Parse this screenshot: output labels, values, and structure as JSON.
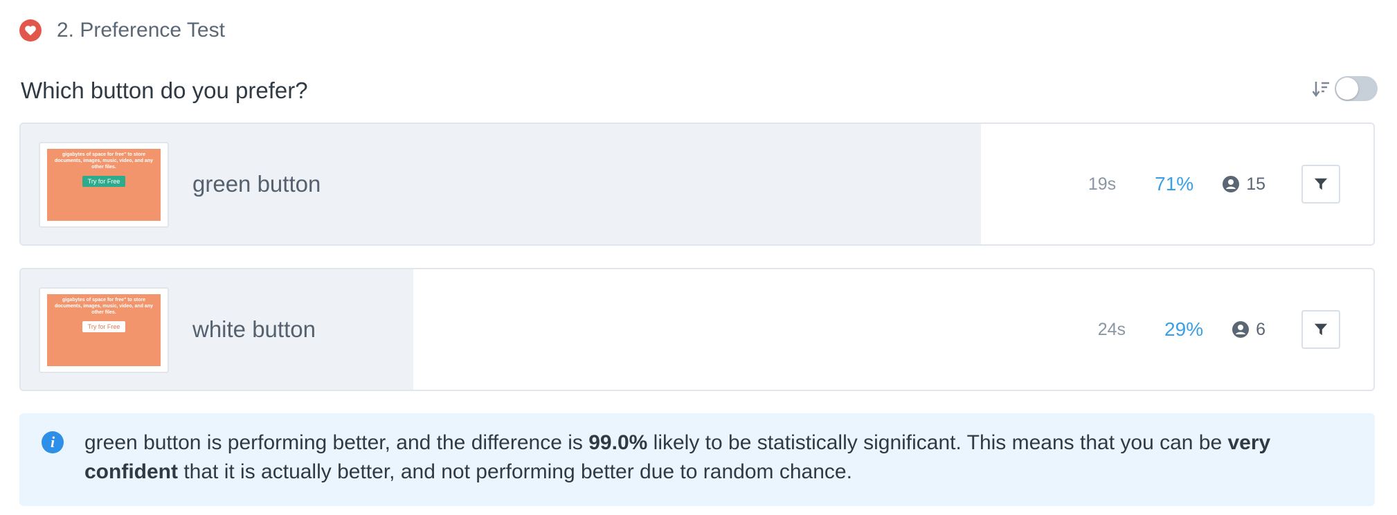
{
  "section": {
    "title": "2. Preference Test",
    "icon": "heart-icon",
    "accent_color": "#e2574c"
  },
  "question": "Which button do you prefer?",
  "controls": {
    "sort_icon": "sort-descending-icon",
    "toggle_on": false
  },
  "options": [
    {
      "label": "green button",
      "time": "19s",
      "percent": "71%",
      "share": 0.71,
      "count": "15",
      "thumbnail": {
        "text": "gigabytes of space for free\" to store documents, images, music, video, and any other files.",
        "cta": "Try for Free",
        "cta_style": "green"
      }
    },
    {
      "label": "white button",
      "time": "24s",
      "percent": "29%",
      "share": 0.29,
      "count": "6",
      "thumbnail": {
        "text": "gigabytes of space for free\" to store documents, images, music, video, and any other files.",
        "cta": "Try for Free",
        "cta_style": "white"
      }
    }
  ],
  "info": {
    "part1": "green button is performing better, and the difference is ",
    "highlight1": "99.0%",
    "part2": " likely to be statistically significant. This means that you can be ",
    "highlight2": "very confident",
    "part3": " that it is actually better, and not performing better due to random chance."
  },
  "colors": {
    "percent": "#3aa0e6",
    "info_bg": "#eaf5fd",
    "thumb_bg": "#f2956d"
  }
}
